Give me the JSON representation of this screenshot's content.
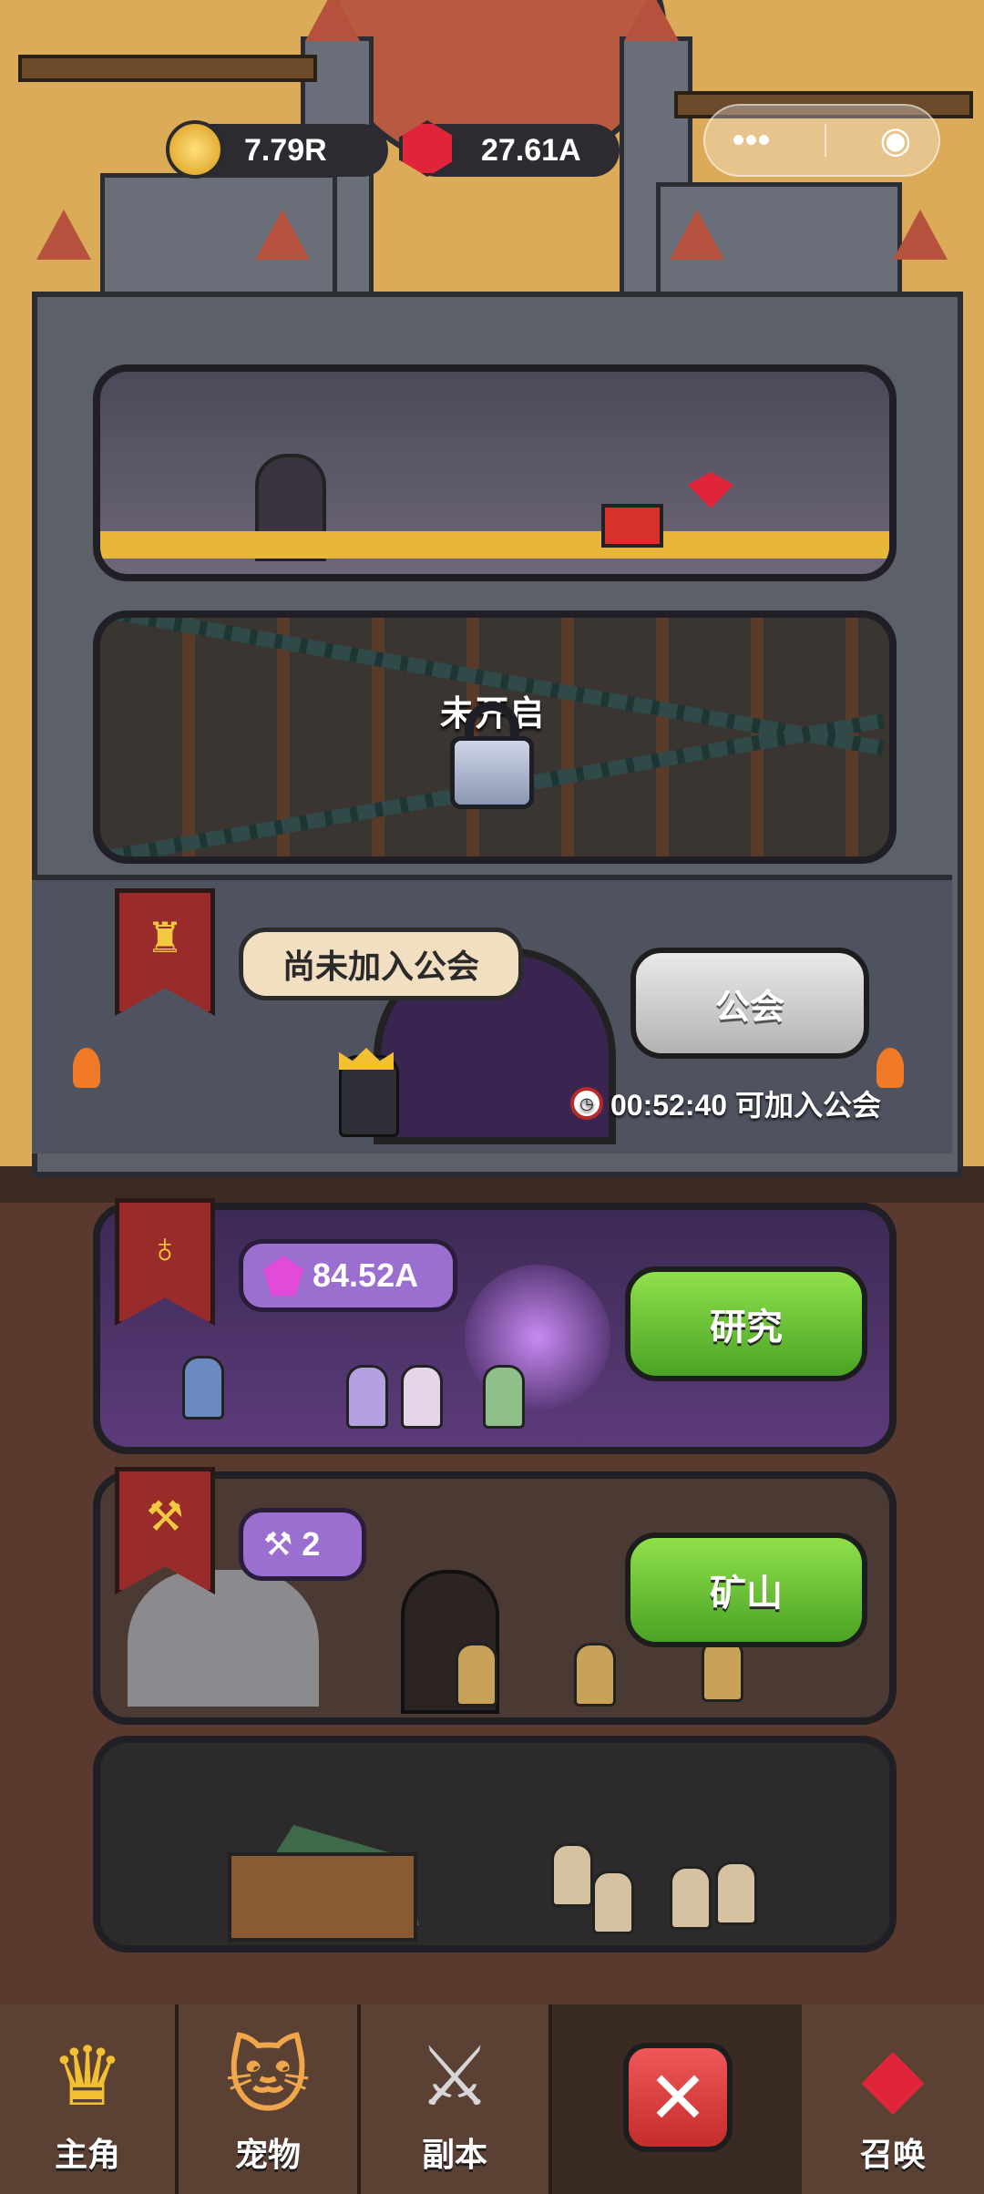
{
  "currency": {
    "gold": "7.79R",
    "gems": "27.61A"
  },
  "miniprogram": {
    "menu_glyph": "•••",
    "close_glyph": "◉"
  },
  "locked_room": {
    "label": "未开启"
  },
  "guild": {
    "bubble": "尚未加入公会",
    "button": "公会",
    "timer": "00:52:40 可加入公会"
  },
  "research": {
    "amount": "84.52A",
    "button": "研究"
  },
  "mine": {
    "count": "2",
    "button": "矿山"
  },
  "nav": {
    "tabs": [
      {
        "label": "主角",
        "icon": "crown-icon"
      },
      {
        "label": "宠物",
        "icon": "cat-icon"
      },
      {
        "label": "副本",
        "icon": "swords-icon"
      },
      {
        "label": "",
        "icon": "close-icon"
      },
      {
        "label": "召唤",
        "icon": "summon-gem-icon"
      }
    ]
  },
  "colors": {
    "accent_green": "#6cc83a",
    "accent_red": "#e0253a",
    "banner_red": "#9a2b2b",
    "purple_bubble": "#9b6fd0"
  }
}
